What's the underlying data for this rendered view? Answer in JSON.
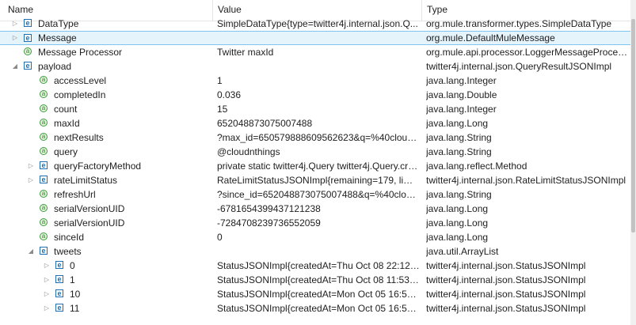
{
  "columns": {
    "name": "Name",
    "value": "Value",
    "type": "Type"
  },
  "icon_names": {
    "expand": "chevron-right-icon",
    "collapse": "chevron-down-icon",
    "object": "object-e-icon",
    "attribute": "attribute-a-icon"
  },
  "rows": [
    {
      "depth": 0,
      "icon": "e",
      "toggle": "collapsed",
      "name": "DataType",
      "value": "SimpleDataType{type=twitter4j.internal.json.Q...",
      "type": "org.mule.transformer.types.SimpleDataType",
      "selected": false
    },
    {
      "depth": 0,
      "icon": "e",
      "toggle": "collapsed",
      "name": "Message",
      "value": "",
      "type": "org.mule.DefaultMuleMessage",
      "selected": true
    },
    {
      "depth": 0,
      "icon": "a",
      "toggle": "none",
      "name": "Message Processor",
      "value": "Twitter maxId",
      "type": "org.mule.api.processor.LoggerMessageProcess...",
      "selected": false
    },
    {
      "depth": 0,
      "icon": "e",
      "toggle": "expanded",
      "name": "payload",
      "value": "",
      "type": "twitter4j.internal.json.QueryResultJSONImpl",
      "selected": false
    },
    {
      "depth": 1,
      "icon": "a",
      "toggle": "none",
      "name": "accessLevel",
      "value": "1",
      "type": "java.lang.Integer",
      "selected": false
    },
    {
      "depth": 1,
      "icon": "a",
      "toggle": "none",
      "name": "completedIn",
      "value": "0.036",
      "type": "java.lang.Double",
      "selected": false
    },
    {
      "depth": 1,
      "icon": "a",
      "toggle": "none",
      "name": "count",
      "value": "15",
      "type": "java.lang.Integer",
      "selected": false
    },
    {
      "depth": 1,
      "icon": "a",
      "toggle": "none",
      "name": "maxId",
      "value": "652048873075007488",
      "type": "java.lang.Long",
      "selected": false
    },
    {
      "depth": 1,
      "icon": "a",
      "toggle": "none",
      "name": "nextResults",
      "value": "?max_id=650579888609562623&q=%40cloudnt...",
      "type": "java.lang.String",
      "selected": false
    },
    {
      "depth": 1,
      "icon": "a",
      "toggle": "none",
      "name": "query",
      "value": "@cloudnthings",
      "type": "java.lang.String",
      "selected": false
    },
    {
      "depth": 1,
      "icon": "e",
      "toggle": "collapsed",
      "name": "queryFactoryMethod",
      "value": "private static twitter4j.Query twitter4j.Query.cre...",
      "type": "java.lang.reflect.Method",
      "selected": false
    },
    {
      "depth": 1,
      "icon": "e",
      "toggle": "collapsed",
      "name": "rateLimitStatus",
      "value": "RateLimitStatusJSONImpl{remaining=179, limit...",
      "type": "twitter4j.internal.json.RateLimitStatusJSONImpl",
      "selected": false
    },
    {
      "depth": 1,
      "icon": "a",
      "toggle": "none",
      "name": "refreshUrl",
      "value": "?since_id=652048873075007488&q=%40cloudn...",
      "type": "java.lang.String",
      "selected": false
    },
    {
      "depth": 1,
      "icon": "a",
      "toggle": "none",
      "name": "serialVersionUID",
      "value": "-6781654399437121238",
      "type": "java.lang.Long",
      "selected": false
    },
    {
      "depth": 1,
      "icon": "a",
      "toggle": "none",
      "name": "serialVersionUID",
      "value": "-7284708239736552059",
      "type": "java.lang.Long",
      "selected": false
    },
    {
      "depth": 1,
      "icon": "a",
      "toggle": "none",
      "name": "sinceId",
      "value": "0",
      "type": "java.lang.Long",
      "selected": false
    },
    {
      "depth": 1,
      "icon": "e",
      "toggle": "expanded",
      "name": "tweets",
      "value": "",
      "type": "java.util.ArrayList",
      "selected": false
    },
    {
      "depth": 2,
      "icon": "e",
      "toggle": "collapsed",
      "name": "0",
      "value": "StatusJSONImpl{createdAt=Thu Oct 08 22:12:2...",
      "type": "twitter4j.internal.json.StatusJSONImpl",
      "selected": false
    },
    {
      "depth": 2,
      "icon": "e",
      "toggle": "collapsed",
      "name": "1",
      "value": "StatusJSONImpl{createdAt=Thu Oct 08 11:53:1...",
      "type": "twitter4j.internal.json.StatusJSONImpl",
      "selected": false
    },
    {
      "depth": 2,
      "icon": "e",
      "toggle": "collapsed",
      "name": "10",
      "value": "StatusJSONImpl{createdAt=Mon Oct 05 16:54:3...",
      "type": "twitter4j.internal.json.StatusJSONImpl",
      "selected": false
    },
    {
      "depth": 2,
      "icon": "e",
      "toggle": "collapsed",
      "name": "11",
      "value": "StatusJSONImpl{createdAt=Mon Oct 05 16:52:5...",
      "type": "twitter4j.internal.json.StatusJSONImpl",
      "selected": false
    }
  ]
}
